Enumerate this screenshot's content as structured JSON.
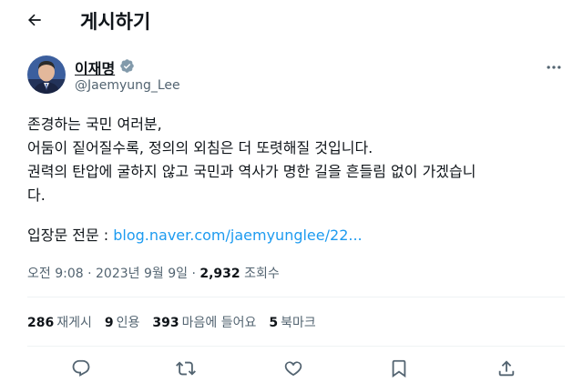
{
  "header": {
    "title": "게시하기",
    "back_icon": "arrow-left-icon"
  },
  "author": {
    "name": "이재명",
    "handle": "@Jaemyung_Lee",
    "verified_icon": "verified-badge-icon",
    "verified_color": "#829aab"
  },
  "tweet": {
    "lines": [
      "존경하는 국민 여러분,",
      "어둠이 짙어질수록, 정의의 외침은 더 또렷해질 것입니다.",
      "권력의 탄압에 굴하지 않고 국민과 역사가 명한 길을 흔들림 없이 가겠습니",
      "다."
    ],
    "link_prefix": "입장문 전문 : ",
    "link_text": "blog.naver.com/jaemyunglee/22..."
  },
  "meta": {
    "time": "오전 9:08",
    "separator": " · ",
    "date": "2023년 9월 9일",
    "views_count": "2,932",
    "views_label": " 조회수"
  },
  "stats": [
    {
      "count": "286",
      "label": "재게시"
    },
    {
      "count": "9",
      "label": "인용"
    },
    {
      "count": "393",
      "label": "마음에 들어요"
    },
    {
      "count": "5",
      "label": "북마크"
    }
  ],
  "actions": [
    "reply-icon",
    "retweet-icon",
    "like-icon",
    "bookmark-icon",
    "share-icon"
  ],
  "colors": {
    "link": "#1d9bf0",
    "secondary_text": "#536471",
    "text": "#0f1419"
  }
}
